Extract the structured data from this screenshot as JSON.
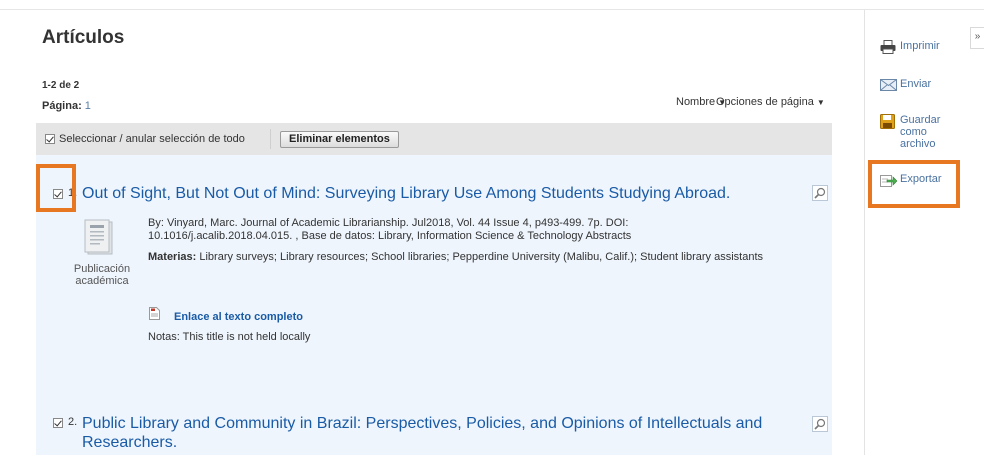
{
  "header": {
    "title": "Artículos",
    "count": "1-2 de 2",
    "page_label": "Página:",
    "page_number": "1",
    "sort_label": "Nombre",
    "page_options_label": "Opciones de página"
  },
  "selection_bar": {
    "select_all_label": "Seleccionar / anular selección de todo",
    "delete_label": "Eliminar elementos"
  },
  "results": [
    {
      "number": "1.",
      "title": "Out of Sight, But Not Out of Mind: Surveying Library Use Among Students Studying Abroad.",
      "citation": "By: Vinyard, Marc. Journal of Academic Librarianship. Jul2018, Vol. 44 Issue 4, p493-499. 7p. DOI: 10.1016/j.acalib.2018.04.015. , Base de datos: Library, Information Science & Technology Abstracts",
      "subjects_label": "Materias:",
      "subjects": "Library surveys; Library resources; School libraries; Pepperdine University (Malibu, Calif.); Student library assistants",
      "pub_type": "Publicación académica",
      "fulltext_link": "Enlace al texto completo",
      "notes": "Notas:  This title is not held locally"
    },
    {
      "number": "2.",
      "title": "Public Library and Community in Brazil: Perspectives, Policies, and Opinions of Intellectuals and Researchers."
    }
  ],
  "tools": {
    "print": "Imprimir",
    "email": "Enviar",
    "save": "Guardar como archivo",
    "export": "Exportar"
  },
  "collapse_label": "»",
  "colors": {
    "link": "#1a5ba6",
    "result_bg": "#eef5fd",
    "highlight": "#e87722"
  }
}
